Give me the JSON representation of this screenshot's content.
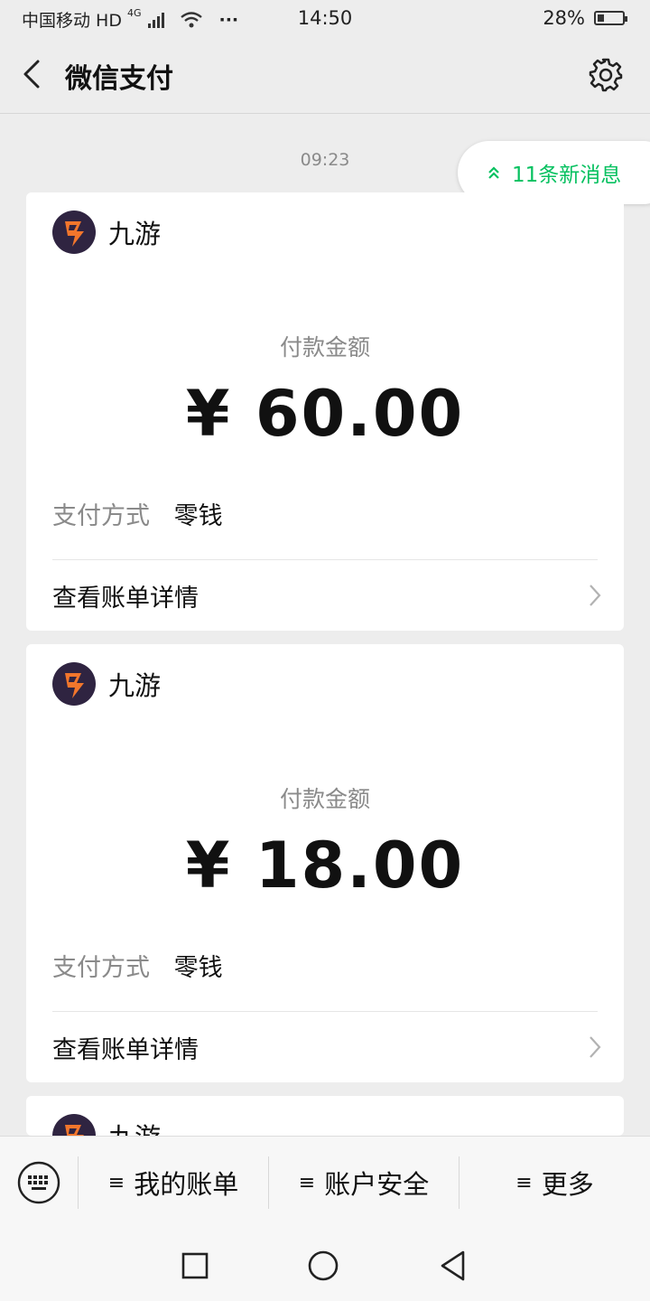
{
  "status_bar": {
    "carrier": "中国移动 HD",
    "network": "4G",
    "dots": "···",
    "time": "14:50",
    "battery_percent": "28%",
    "battery_level": 0.28
  },
  "navbar": {
    "title": "微信支付"
  },
  "timeline": {
    "time": "09:23"
  },
  "new_messages": {
    "label": "11条新消息"
  },
  "cards": [
    {
      "merchant": "九游",
      "amount_label": "付款金额",
      "amount": "¥ 60.00",
      "pay_method_key": "支付方式",
      "pay_method_value": "零钱",
      "detail_link": "查看账单详情"
    },
    {
      "merchant": "九游",
      "amount_label": "付款金额",
      "amount": "¥ 18.00",
      "pay_method_key": "支付方式",
      "pay_method_value": "零钱",
      "detail_link": "查看账单详情"
    },
    {
      "merchant": "九游"
    }
  ],
  "bottom_menu": {
    "items": [
      "我的账单",
      "账户安全",
      "更多"
    ],
    "menu_glyph": "≡"
  },
  "colors": {
    "accent_green": "#07c160",
    "background": "#ededed",
    "card": "#ffffff",
    "logo_bg": "#2f2441",
    "logo_orange": "#f2762c"
  },
  "icons": {
    "back": "back-arrow-icon",
    "settings": "gear-icon",
    "new_messages": "double-chevron-up-icon",
    "chevron": "chevron-right-icon",
    "keyboard": "keyboard-icon",
    "sys_recent": "square-icon",
    "sys_home": "circle-icon",
    "sys_back": "triangle-back-icon"
  }
}
